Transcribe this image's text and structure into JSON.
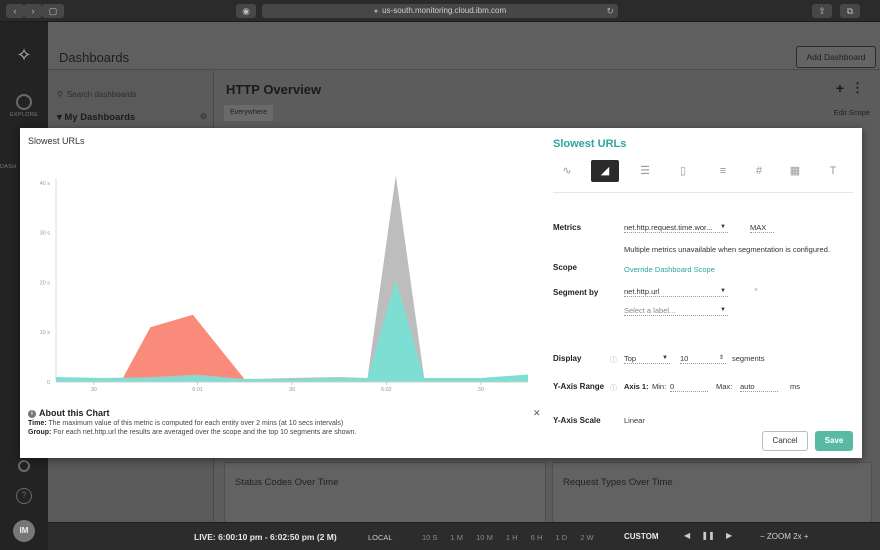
{
  "browser": {
    "url": "us-south.monitoring.cloud.ibm.com"
  },
  "rail": {
    "explore_label": "EXPLORE",
    "dash_label": "DASH"
  },
  "app": {
    "title": "Dashboards",
    "add_dashboard": "Add Dashboard",
    "search_placeholder": "Search dashboards",
    "my_dashboards": "My Dashboards",
    "dashboard_title": "HTTP Overview",
    "scope_chip": "Everywhere",
    "edit_scope": "Edit Scope",
    "panels": [
      "Status Codes Over Time",
      "Request Types Over Time"
    ]
  },
  "timebar": {
    "live": "LIVE: 6:00:10 pm - 6:02:50 pm (2 M)",
    "local": "LOCAL",
    "ranges": [
      "10 S",
      "1 M",
      "10 M",
      "1 H",
      "6 H",
      "1 D",
      "2 W"
    ],
    "custom": "CUSTOM",
    "zoom": "ZOOM 2x"
  },
  "modal": {
    "chart_title": "Slowest URLs",
    "about_title": "About this Chart",
    "about_time_label": "Time:",
    "about_time_text": "The maximum value of this metric is computed for each entity over 2 mins (at 10 secs intervals)",
    "about_group_label": "Group:",
    "about_group_text": "For each net.http.url the results are averaged over the scope and the top 10 segments are shown.",
    "config_title": "Slowest URLs",
    "metrics_label": "Metrics",
    "metric_value": "net.http.request.time.wor...",
    "metric_agg": "MAX",
    "metrics_note": "Multiple metrics unavailable when segmentation is configured.",
    "scope_label": "Scope",
    "scope_link": "Override Dashboard Scope",
    "segment_label": "Segment by",
    "segment_value": "net.http.url",
    "segment_placeholder": "Select a label...",
    "display_label": "Display",
    "display_mode": "Top",
    "display_count": "10",
    "display_unit": "segments",
    "yrange_label": "Y-Axis Range",
    "yrange_axis": "Axis 1:",
    "yrange_min_label": "Min:",
    "yrange_min": "0",
    "yrange_max_label": "Max:",
    "yrange_max": "auto",
    "yrange_unit": "ms",
    "yscale_label": "Y-Axis Scale",
    "yscale_value": "Linear",
    "cancel": "Cancel",
    "save": "Save"
  },
  "chart_data": {
    "type": "area",
    "title": "Slowest URLs",
    "y_ticks": [
      "0",
      "10 s",
      "20 s",
      "30 s",
      "40 s"
    ],
    "x_ticks": [
      "30",
      "6:01",
      "30",
      "6:02",
      "30"
    ],
    "ylim": [
      0,
      45
    ],
    "series": [
      {
        "color": "#fa8a7a",
        "x": [
          0,
          14,
          20,
          29,
          40,
          50,
          60,
          68,
          73,
          78,
          84,
          90,
          100
        ],
        "values": [
          0.5,
          0.5,
          11,
          13.5,
          0.5,
          0.5,
          0.5,
          0.5,
          0.5,
          0.5,
          0.5,
          0.5,
          0.5
        ]
      },
      {
        "color": "#bdbdbd",
        "x": [
          0,
          10,
          20,
          30,
          40,
          50,
          60,
          66,
          72,
          78,
          84,
          90,
          100
        ],
        "values": [
          0.8,
          0.8,
          1.0,
          1.5,
          0.6,
          0.8,
          1.0,
          0.8,
          41.5,
          0.8,
          0.8,
          0.8,
          1.2
        ]
      },
      {
        "color": "#7ddfd3",
        "x": [
          0,
          10,
          20,
          30,
          40,
          50,
          60,
          66,
          72,
          78,
          84,
          90,
          100
        ],
        "values": [
          1.0,
          0.8,
          0.8,
          1.2,
          0.6,
          0.6,
          0.8,
          0.8,
          20.5,
          0.8,
          0.8,
          0.8,
          1.5
        ]
      }
    ],
    "grid": false
  }
}
